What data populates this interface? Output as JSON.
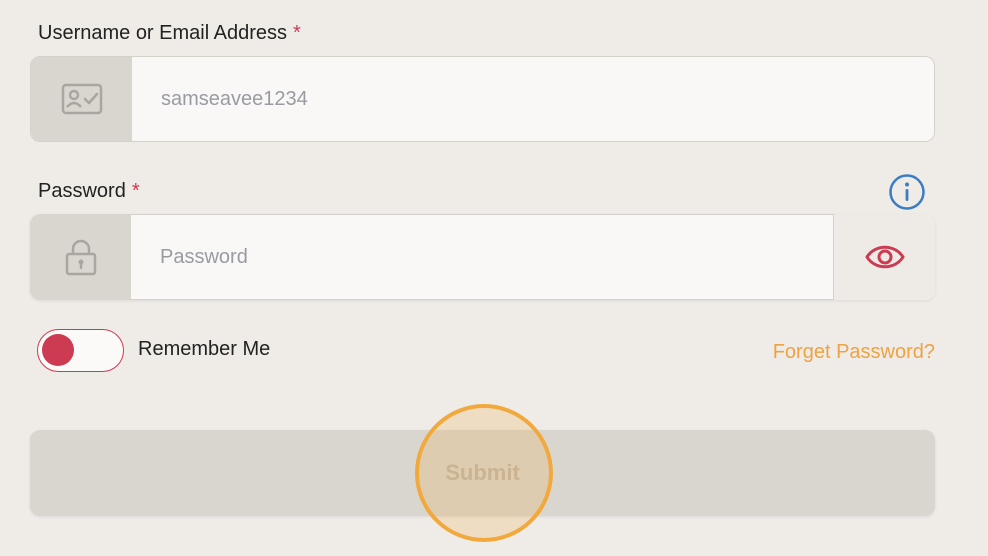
{
  "username": {
    "label": "Username or Email Address",
    "required_mark": "*",
    "value": "",
    "placeholder": "samseavee1234",
    "icon": "id-card-icon"
  },
  "password": {
    "label": "Password",
    "required_mark": "*",
    "value": "",
    "placeholder": "Password",
    "icon": "lock-icon",
    "info_icon": "info-icon",
    "toggle_icon": "eye-icon"
  },
  "remember": {
    "label": "Remember Me",
    "toggle_state": "off"
  },
  "forgot_link": "Forget Password?",
  "submit_label": "Submit",
  "colors": {
    "background": "#efece8",
    "required": "#cc3b52",
    "accent_red": "#cc3b52",
    "link": "#eea240",
    "info_blue": "#3b7cc4",
    "tap_ring": "#f1a93e",
    "submit_disabled_bg": "#d9d6d0",
    "submit_disabled_text": "#bfb6aa"
  }
}
